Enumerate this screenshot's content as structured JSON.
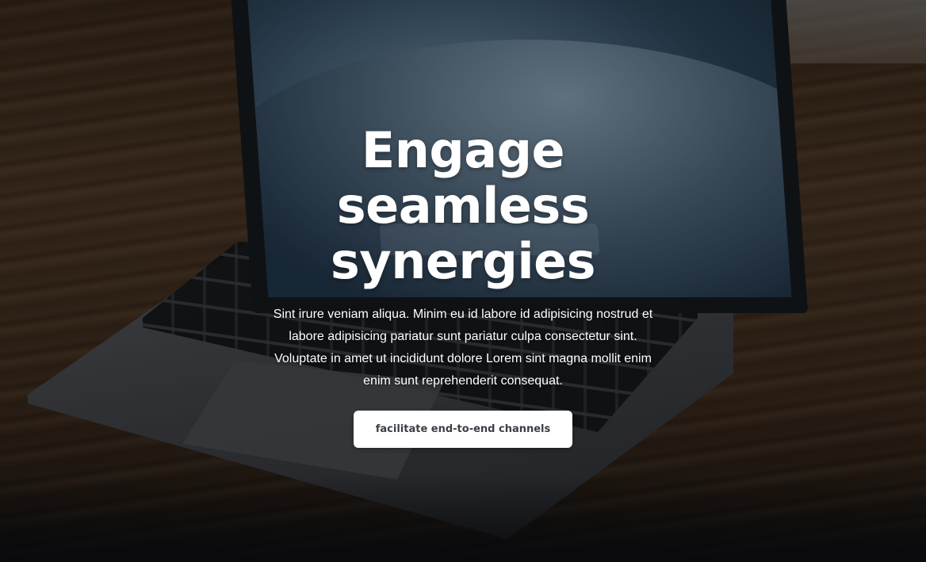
{
  "hero": {
    "headline": "Engage seamless synergies",
    "description": "Sint irure veniam aliqua. Minim eu id labore id adipisicing nostrud et labore adipisicing pariatur sunt pariatur culpa consectetur sint. Voluptate in amet ut incididunt dolore Lorem sint magna mollit enim enim sunt reprehenderit consequat.",
    "cta_label": "facilitate end-to-end channels",
    "background_image": "laptop-on-wooden-desk",
    "cta_background": "#ffffff",
    "cta_text_color": "#3a3f45"
  }
}
